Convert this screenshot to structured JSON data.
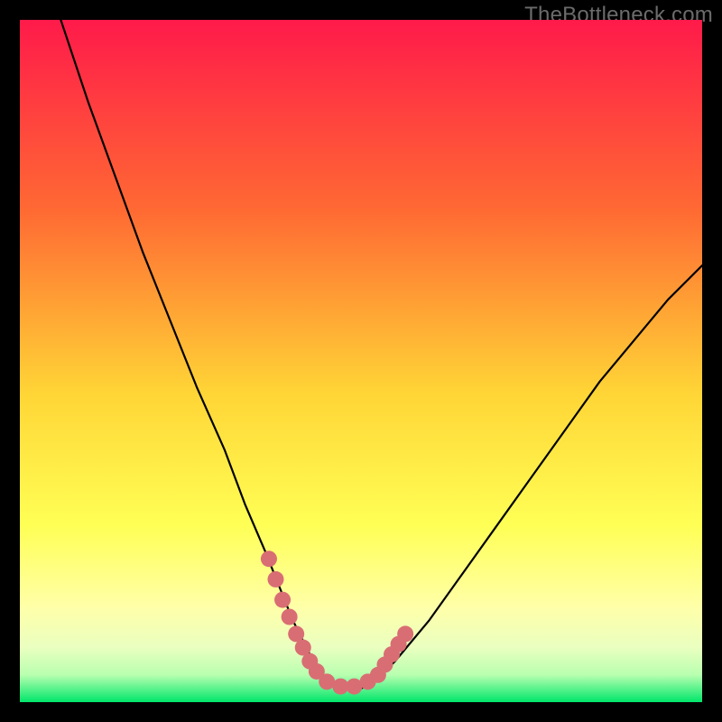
{
  "watermark": "TheBottleneck.com",
  "colors": {
    "background": "#000000",
    "gradient_top": "#ff1a4a",
    "gradient_mid_upper": "#ff7a2e",
    "gradient_mid": "#ffd636",
    "gradient_mid_lower": "#ffff72",
    "gradient_low": "#f6ffb9",
    "gradient_bottom": "#00e66a",
    "curve": "#000000",
    "marker": "#d96d74"
  },
  "chart_data": {
    "type": "line",
    "title": "",
    "xlabel": "",
    "ylabel": "",
    "xlim": [
      0,
      100
    ],
    "ylim": [
      0,
      100
    ],
    "grid": false,
    "legend": false,
    "series": [
      {
        "name": "bottleneck-curve",
        "x": [
          6,
          10,
          14,
          18,
          22,
          26,
          30,
          33,
          36,
          38,
          40,
          42,
          43.5,
          45,
          47,
          50,
          52,
          55,
          60,
          65,
          70,
          75,
          80,
          85,
          90,
          95,
          100
        ],
        "y": [
          100,
          88,
          77,
          66,
          56,
          46,
          37,
          29,
          22,
          17,
          12,
          8,
          5,
          3,
          2,
          2,
          3,
          6,
          12,
          19,
          26,
          33,
          40,
          47,
          53,
          59,
          64
        ]
      }
    ],
    "markers": {
      "name": "optimal-range",
      "x": [
        36.5,
        37.5,
        38.5,
        39.5,
        40.5,
        41.5,
        42.5,
        43.5,
        45,
        47,
        49,
        51,
        52.5,
        53.5,
        54.5,
        55.5,
        56.5
      ],
      "y": [
        21,
        18,
        15,
        12.5,
        10,
        8,
        6,
        4.5,
        3,
        2.3,
        2.3,
        3,
        4,
        5.5,
        7,
        8.5,
        10
      ],
      "radius": 9
    }
  }
}
